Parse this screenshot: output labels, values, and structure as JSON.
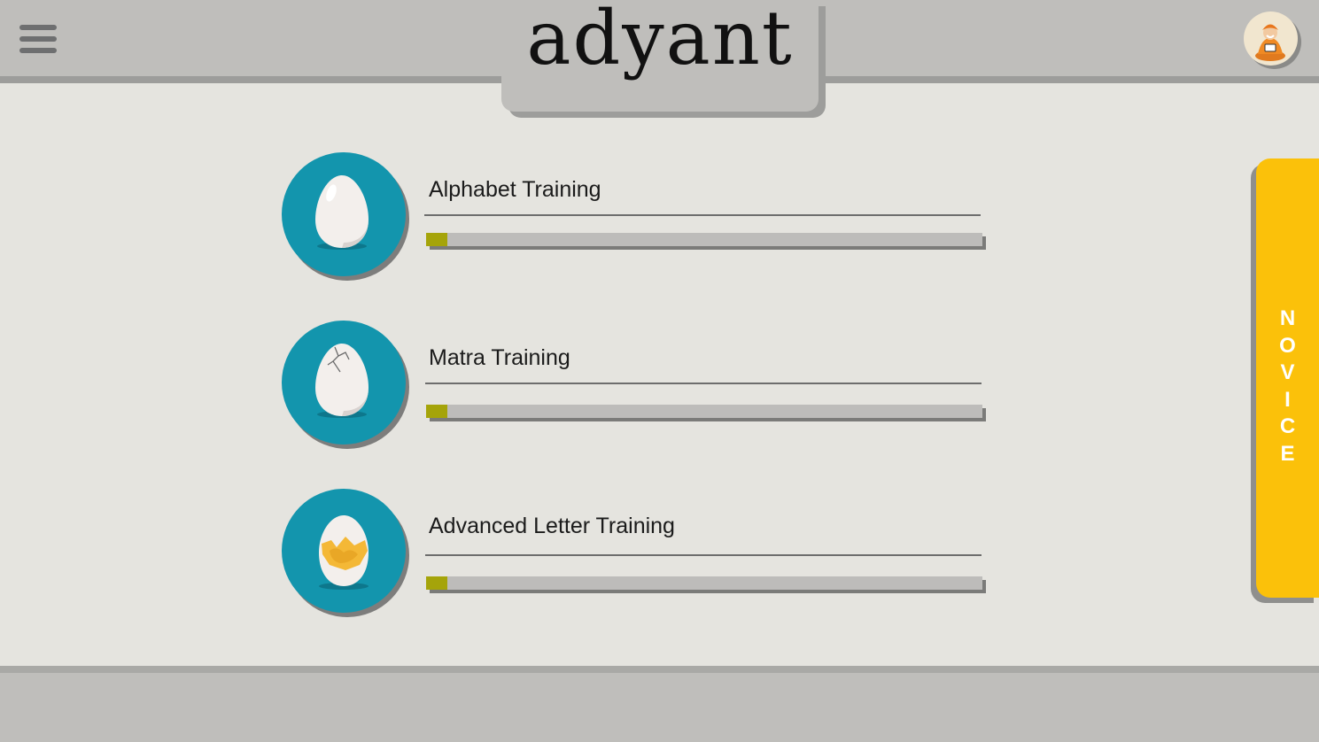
{
  "header": {
    "logo_text": "adyant",
    "menu_icon": "hamburger-menu-icon",
    "avatar_icon": "meditating-monk-avatar-icon"
  },
  "courses": [
    {
      "title": "Alphabet Training",
      "egg_icon": "whole-egg-icon",
      "progress": 0.04
    },
    {
      "title": "Matra Training",
      "egg_icon": "cracked-egg-icon",
      "progress": 0.04
    },
    {
      "title": "Advanced Letter Training",
      "egg_icon": "hatching-egg-icon",
      "progress": 0.04
    }
  ],
  "level_tab": {
    "label": "NOVICE"
  },
  "colors": {
    "accent_teal": "#1395ad",
    "level_yellow": "#fbc10a",
    "progress_olive": "#a5a40a",
    "header_gray": "#bfbebb",
    "background": "#e5e4df"
  }
}
